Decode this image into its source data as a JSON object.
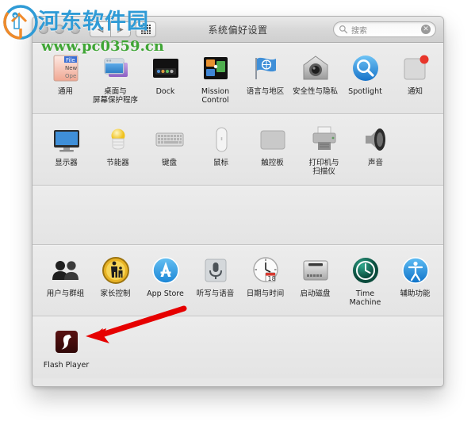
{
  "window": {
    "title": "系统偏好设置",
    "traffic_lights": [
      "close",
      "minimize",
      "zoom"
    ],
    "nav": {
      "back_label": "◀",
      "forward_label": "▶",
      "grid_label": "show-all-grid"
    },
    "search": {
      "placeholder": "搜索",
      "clear_label": "✕",
      "icon": "search-icon"
    }
  },
  "watermark": {
    "site_name": "河东软件园",
    "url": "www.pc0359.cn",
    "name_color": "#2f9bd6",
    "url_color": "#3fa535"
  },
  "annotation": {
    "arrow_color": "#e60000",
    "points_to": "Flash Player"
  },
  "sections": [
    {
      "name": "personal",
      "items": [
        {
          "label": "通用",
          "icon": "general-icon"
        },
        {
          "label": "桌面与\n屏幕保护程序",
          "icon": "desktop-screensaver-icon"
        },
        {
          "label": "Dock",
          "icon": "dock-icon"
        },
        {
          "label": "Mission\nControl",
          "icon": "mission-control-icon"
        },
        {
          "label": "语言与地区",
          "icon": "language-region-icon"
        },
        {
          "label": "安全性与隐私",
          "icon": "security-privacy-icon"
        },
        {
          "label": "Spotlight",
          "icon": "spotlight-icon"
        },
        {
          "label": "通知",
          "icon": "notifications-icon"
        }
      ]
    },
    {
      "name": "hardware",
      "items": [
        {
          "label": "显示器",
          "icon": "displays-icon"
        },
        {
          "label": "节能器",
          "icon": "energy-saver-icon"
        },
        {
          "label": "键盘",
          "icon": "keyboard-icon"
        },
        {
          "label": "鼠标",
          "icon": "mouse-icon"
        },
        {
          "label": "触控板",
          "icon": "trackpad-icon"
        },
        {
          "label": "打印机与\n扫描仪",
          "icon": "printers-scanners-icon"
        },
        {
          "label": "声音",
          "icon": "sound-icon"
        }
      ]
    },
    {
      "name": "internet-accounts",
      "items": []
    },
    {
      "name": "system",
      "items": [
        {
          "label": "用户与群组",
          "icon": "users-groups-icon"
        },
        {
          "label": "家长控制",
          "icon": "parental-controls-icon"
        },
        {
          "label": "App Store",
          "icon": "app-store-icon"
        },
        {
          "label": "听写与语音",
          "icon": "dictation-speech-icon"
        },
        {
          "label": "日期与时间",
          "icon": "date-time-icon"
        },
        {
          "label": "启动磁盘",
          "icon": "startup-disk-icon"
        },
        {
          "label": "Time Machine",
          "icon": "time-machine-icon"
        },
        {
          "label": "辅助功能",
          "icon": "accessibility-icon"
        }
      ]
    },
    {
      "name": "third-party",
      "items": [
        {
          "label": "Flash Player",
          "icon": "flash-player-icon"
        }
      ]
    }
  ]
}
